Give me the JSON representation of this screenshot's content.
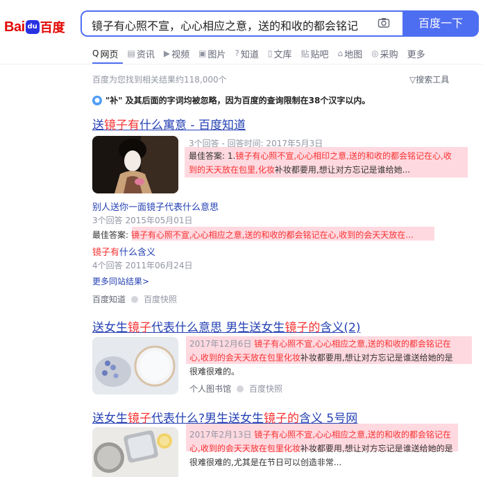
{
  "logo": {
    "part1": "Bai",
    "part2": "du",
    "part3": "百度"
  },
  "search": {
    "query": "镜子有心照不宣，心心相应之意，送的和收的都会铭记",
    "button": "百度一下"
  },
  "tabs": [
    {
      "icon": "Q",
      "label": "网页"
    },
    {
      "icon": "▤",
      "label": "资讯"
    },
    {
      "icon": "▶",
      "label": "视频"
    },
    {
      "icon": "▣",
      "label": "图片"
    },
    {
      "icon": "?",
      "label": "知道"
    },
    {
      "icon": "▯",
      "label": "文库"
    },
    {
      "icon": "贴",
      "label": "贴吧"
    },
    {
      "icon": "⌂",
      "label": "地图"
    },
    {
      "icon": "◎",
      "label": "采购"
    },
    {
      "icon": "",
      "label": "更多"
    }
  ],
  "results_count": "百度为您找到相关结果约118,000个",
  "tools": "▽搜索工具",
  "notice": {
    "icon": "●",
    "text": "\"补\" 及其后面的字词均被忽略，因为百度的查询限制在38个汉字以内。"
  },
  "result1": {
    "title_pre": "送",
    "title_em": "镜子有",
    "title_post": "什么寓意 - 百度知道",
    "meta": "3个回答 - 回答时间: 2017年5月3日",
    "answer_label": "最佳答案: 1.",
    "answer_line1": "镜子有心照不宣,心心相印之意,送的和收的都会铭记在心,收",
    "answer_line2_red": "到的天天放在包里,化妆",
    "answer_line2_rest": "补妆都要用,想让对方忘记是谁给她...",
    "sub1_title": "别人送你一面镜子代表什么意思",
    "sub1_meta": "3个回答  2015年05月01日",
    "sub1_label": "最佳答案: ",
    "sub1_answer": "镜子有心照不宣,心心相应之意,送的和收的都会铭记在心,收到的会天天放在...",
    "sub2_em": "镜子有",
    "sub2_post": "什么含义",
    "sub2_meta": "4个回答  2011年06月24日",
    "more": "更多同站结果>",
    "source": "百度知道",
    "snapshot": "百度快照"
  },
  "result2": {
    "title_pre": "送女生",
    "title_em1": "镜子",
    "title_mid": "代表什么意思 男生送女生",
    "title_em2": "镜子的",
    "title_post": "含义(2)",
    "line1_date": "2017年12月6日 ",
    "line1_red": "镜子有心照不宣,心心相应之意,送的和收的都会铭记在",
    "line2_red": "心,收到的会天天放在包里化妆",
    "line2_rest": "补妆都要用,想让对方忘记是谁送给她的是",
    "line3": "很难很难的。",
    "source": "个人图书馆",
    "snapshot": "百度快照"
  },
  "result3": {
    "title_pre": "送女生",
    "title_em1": "镜子",
    "title_mid": "代表什么?男生送女生",
    "title_em2": "镜子的",
    "title_post": "含义  5号网",
    "line1_date": "2017年2月13日 ",
    "line1_red": "镜子有心照不宣,心心相应之意,送的和收的都会铭记在",
    "line2_red": "心,收到的会天天放在包里化妆",
    "line2_rest": "补妆都要用,想让对方忘记是谁送给她的是",
    "line3": "很难很难的,尤其是在节日可以创造非常..."
  },
  "colors": {
    "brand_blue": "#4e6ef2",
    "link": "#2440b3",
    "highlight": "#f73131",
    "logo_red": "#e10602"
  }
}
